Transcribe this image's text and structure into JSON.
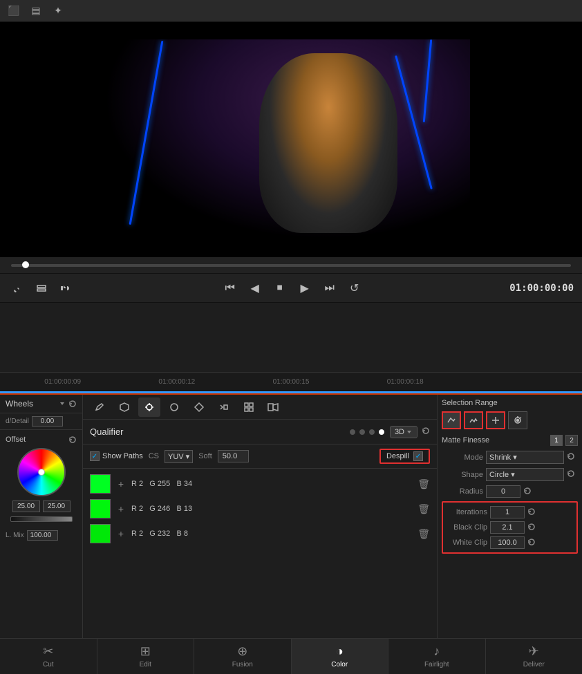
{
  "toolbar": {
    "icon1": "⬛",
    "icon2": "⬜",
    "icon3": "✦"
  },
  "playback": {
    "timecode": "01:00:00:00",
    "progress": "2%"
  },
  "timeline": {
    "markers": [
      "01:00:00:09",
      "01:00:00:12",
      "01:00:00:15",
      "01:00:00:18",
      ""
    ]
  },
  "wheels": {
    "label": "Wheels",
    "detail_label": "d/Detail",
    "detail_value": "0.00",
    "offset_label": "Offset",
    "val1": "25.00",
    "val2": "25.00",
    "lmix_label": "L. Mix",
    "lmix_value": "100.00"
  },
  "qualifier": {
    "title": "Qualifier",
    "show_paths": "Show Paths",
    "cs_label": "CS",
    "cs_value": "YUV",
    "soft_label": "Soft",
    "soft_value": "50.0",
    "despill_label": "Despill",
    "3d_label": "3D"
  },
  "color_rows": [
    {
      "r": "R 2",
      "g": "G 255",
      "b": "B 34"
    },
    {
      "r": "R 2",
      "g": "G 246",
      "b": "B 13"
    },
    {
      "r": "R 2",
      "g": "G 232",
      "b": "B 8"
    }
  ],
  "selection_range": {
    "title": "Selection Range"
  },
  "matte_finesse": {
    "title": "Matte Finesse",
    "mode_label": "Mode",
    "mode_value": "Shrink",
    "shape_label": "Shape",
    "shape_value": "Circle",
    "radius_label": "Radius",
    "radius_value": "0",
    "iterations_label": "Iterations",
    "iterations_value": "1",
    "black_clip_label": "Black Clip",
    "black_clip_value": "2.1",
    "white_clip_label": "White Clip",
    "white_clip_value": "100.0"
  },
  "tools": {
    "icons": [
      "✏",
      "⬡",
      "✚",
      "◎",
      "◈",
      "◉",
      "▣",
      "🎞"
    ]
  },
  "bottom_nav": [
    {
      "label": "Cut",
      "icon": "✂"
    },
    {
      "label": "Edit",
      "icon": "⊞"
    },
    {
      "label": "Fusion",
      "icon": "⊕"
    },
    {
      "label": "Color",
      "icon": "◑"
    },
    {
      "label": "Fairlight",
      "icon": "♪"
    },
    {
      "label": "Deliver",
      "icon": "✈"
    }
  ]
}
